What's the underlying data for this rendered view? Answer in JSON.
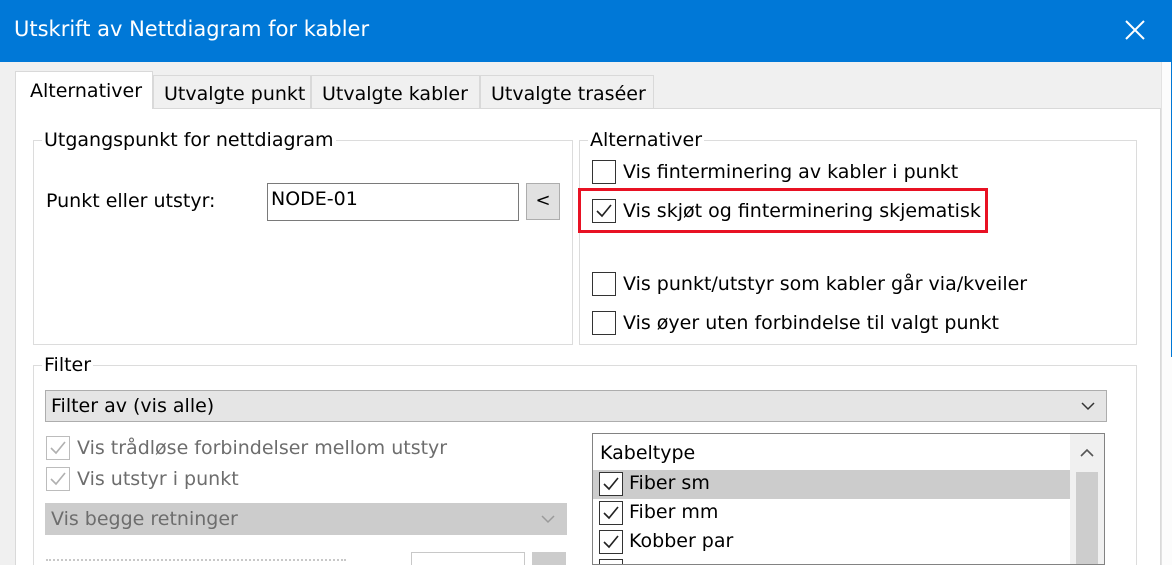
{
  "window": {
    "title": "Utskrift av Nettdiagram for kabler"
  },
  "tabs": [
    {
      "label": "Alternativer",
      "active": true
    },
    {
      "label": "Utvalgte punkt",
      "active": false
    },
    {
      "label": "Utvalgte kabler",
      "active": false
    },
    {
      "label": "Utvalgte traséer",
      "active": false
    }
  ],
  "origin_group": {
    "title": "Utgangspunkt for nettdiagram",
    "point_label": "Punkt eller utstyr:",
    "point_value": "NODE-01",
    "pick_button": "<"
  },
  "options_group": {
    "title": "Alternativer",
    "checkboxes": [
      {
        "label": "Vis finterminering av kabler i punkt",
        "checked": false
      },
      {
        "label": "Vis skjøt og finterminering skjematisk",
        "checked": true,
        "highlighted": true
      },
      {
        "label": "Vis punkt/utstyr som kabler går via/kveiler",
        "checked": false
      },
      {
        "label": "Vis øyer uten forbindelse til valgt punkt",
        "checked": false
      }
    ]
  },
  "filter_group": {
    "title": "Filter",
    "filter_select": "Filter av (vis alle)",
    "checkboxes": [
      {
        "label": "Vis trådløse forbindelser mellom utstyr",
        "checked": true,
        "disabled": true
      },
      {
        "label": "Vis utstyr i punkt",
        "checked": true,
        "disabled": true
      }
    ],
    "direction_select": "Vis begge retninger",
    "cable_types": {
      "header": "Kabeltype",
      "items": [
        {
          "label": "Fiber sm",
          "checked": true,
          "selected": true
        },
        {
          "label": "Fiber mm",
          "checked": true,
          "selected": false
        },
        {
          "label": "Kobber par",
          "checked": true,
          "selected": false
        }
      ]
    }
  },
  "icons": {
    "close": "close-icon",
    "checkmark": "checkmark-icon",
    "dropdown": "chevron-down-icon",
    "scroll_up": "scroll-up-icon"
  },
  "colors": {
    "titlebar": "#0078d7",
    "highlight": "#e81123",
    "disabled_text": "#6d6d6d"
  }
}
